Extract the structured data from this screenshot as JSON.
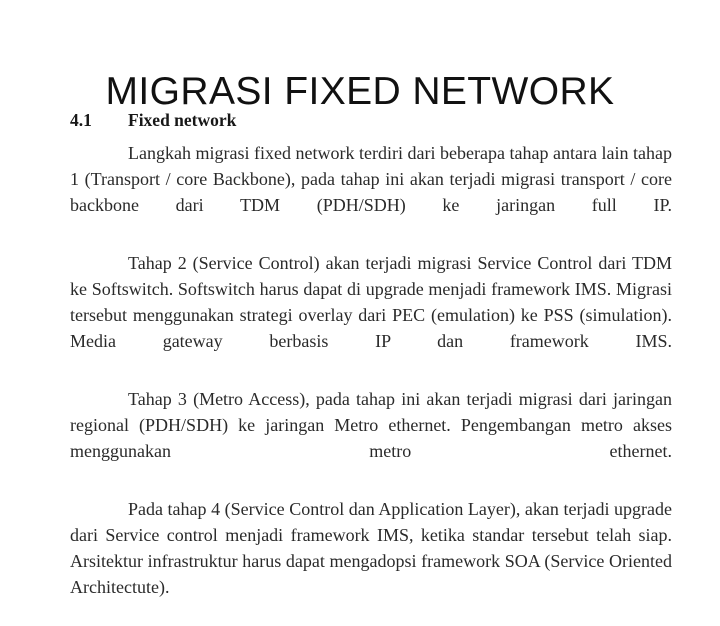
{
  "slide": {
    "title": "MIGRASI FIXED NETWORK",
    "background_color": "#ffffff",
    "text_color": "#2a2a2a",
    "title_color": "#111111"
  },
  "section": {
    "number": "4.1",
    "heading": "Fixed network"
  },
  "paragraphs": [
    {
      "id": "tahap-1",
      "text": "Langkah migrasi fixed network terdiri dari beberapa tahap antara lain tahap 1 (Transport / core Backbone), pada tahap ini akan terjadi migrasi transport / core backbone dari TDM (PDH/SDH) ke jaringan full IP."
    },
    {
      "id": "tahap-2",
      "text": "Tahap 2 (Service Control) akan terjadi migrasi Service Control dari TDM ke Softswitch. Softswitch harus dapat di upgrade menjadi framework IMS. Migrasi tersebut menggunakan strategi overlay dari PEC (emulation) ke PSS (simulation). Media gateway berbasis IP dan framework IMS."
    },
    {
      "id": "tahap-3",
      "text": "Tahap 3 (Metro Access), pada tahap ini akan terjadi migrasi dari jaringan regional (PDH/SDH) ke jaringan Metro ethernet. Pengembangan metro akses menggunakan metro ethernet."
    },
    {
      "id": "tahap-4",
      "text": "Pada tahap 4 (Service Control dan Application Layer), akan terjadi upgrade dari Service control menjadi framework IMS, ketika standar tersebut telah siap. Arsitektur infrastruktur harus dapat mengadopsi framework SOA (Service Oriented Architectute)."
    }
  ]
}
